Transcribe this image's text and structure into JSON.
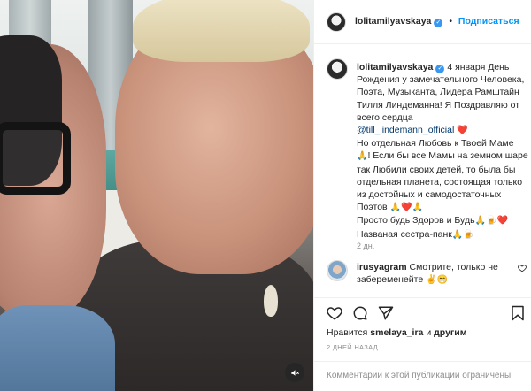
{
  "header": {
    "username": "lolitamilyavskaya",
    "verified_icon": "verified-badge-icon",
    "separator": "•",
    "follow_label": "Подписаться"
  },
  "caption": {
    "username": "lolitamilyavskaya",
    "verified_icon": "verified-badge-icon",
    "date_inline": "4 января",
    "text_part1": "День Рождения у замечательного Человека, Поэта, Музыканта, Лидера Рамштайн Тилля Линдеманна! Я Поздравляю от всего сердца",
    "mention": "@till_lindemann_official",
    "text_part2": "Но отдельная Любовь к Твоей Маме",
    "text_part3": "! Если бы все Мамы на земном шаре так Любили своих детей, то была бы отдельная планета, состоящая только из достойных и самодостаточных Поэтов",
    "text_part4": "Просто будь Здоров и Будь",
    "text_part5": "Названая сестра-панк",
    "emoji_heart": "❤️",
    "emoji_pray": "🙏",
    "emoji_beer": "🍺",
    "time_ago": "2 дн."
  },
  "comment": {
    "username": "irusyagram",
    "text": "Смотрите, только не забеременейте",
    "emoji": "✌️😁"
  },
  "likes": {
    "prefix": "Нравится",
    "user": "smelaya_ira",
    "suffix": "и",
    "others": "другим"
  },
  "date_label": "2 ДНЕЙ НАЗАД",
  "comments_limited": "Комментарии к этой публикации ограничены.",
  "colors": {
    "link_blue": "#0095f6",
    "mention_blue": "#00376b",
    "secondary_text": "#8e8e8e",
    "border": "#efefef"
  }
}
